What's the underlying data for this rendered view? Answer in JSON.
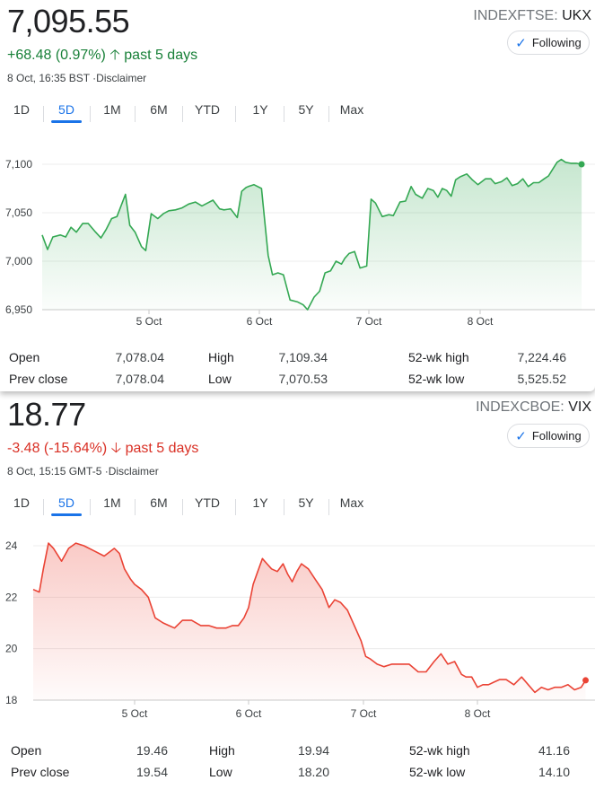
{
  "colors": {
    "up": "#188038",
    "down": "#d93025",
    "up_line": "#34a853",
    "down_line": "#ea4335",
    "accent": "#1a73e8"
  },
  "ranges": [
    "1D",
    "5D",
    "1M",
    "6M",
    "YTD",
    "1Y",
    "5Y",
    "Max"
  ],
  "selected_range": "5D",
  "follow_label": "Following",
  "panels": [
    {
      "price": "7,095.55",
      "exchange": "INDEXFTSE:",
      "symbol": "UKX",
      "change": "+68.48 (0.97%)",
      "period": "past 5 days",
      "timestamp": "8 Oct, 16:35 BST",
      "disclaimer": "·Disclaimer",
      "stats": {
        "open_label": "Open",
        "open": "7,078.04",
        "high_label": "High",
        "high": "7,109.34",
        "wkhigh_label": "52-wk high",
        "wkhigh": "7,224.46",
        "prev_label": "Prev close",
        "prev": "7,078.04",
        "low_label": "Low",
        "low": "7,070.53",
        "wklow_label": "52-wk low",
        "wklow": "5,525.52"
      }
    },
    {
      "price": "18.77",
      "exchange": "INDEXCBOE:",
      "symbol": "VIX",
      "change": "-3.48 (-15.64%)",
      "period": "past 5 days",
      "timestamp": "8 Oct, 15:15 GMT-5",
      "disclaimer": "·Disclaimer",
      "stats": {
        "open_label": "Open",
        "open": "19.46",
        "high_label": "High",
        "high": "19.94",
        "wkhigh_label": "52-wk high",
        "wkhigh": "41.16",
        "prev_label": "Prev close",
        "prev": "19.54",
        "low_label": "Low",
        "low": "18.20",
        "wklow_label": "52-wk low",
        "wklow": "14.10"
      }
    }
  ],
  "chart_data": [
    {
      "type": "area",
      "direction": "up",
      "yticks": [
        6950,
        7000,
        7050,
        7100
      ],
      "ytick_labels": [
        "6,950",
        "7,000",
        "7,050",
        "7,100"
      ],
      "ylim": [
        6950,
        7125
      ],
      "xlim": [
        0,
        5
      ],
      "xticks": [
        1,
        2,
        3,
        4
      ],
      "xtick_labels": [
        "5 Oct",
        "6 Oct",
        "7 Oct",
        "8 Oct"
      ],
      "grid": true,
      "x": [
        0.0,
        0.05,
        0.1,
        0.17,
        0.22,
        0.27,
        0.32,
        0.38,
        0.43,
        0.5,
        0.55,
        0.6,
        0.65,
        0.7,
        0.78,
        0.82,
        0.87,
        0.93,
        0.97,
        1.02,
        1.08,
        1.13,
        1.18,
        1.24,
        1.3,
        1.36,
        1.42,
        1.48,
        1.53,
        1.58,
        1.64,
        1.68,
        1.74,
        1.8,
        1.84,
        1.88,
        1.9,
        1.95,
        2.02,
        2.08,
        2.12,
        2.17,
        2.22,
        2.28,
        2.35,
        2.4,
        2.44,
        2.5,
        2.55,
        2.6,
        2.65,
        2.7,
        2.75,
        2.78,
        2.82,
        2.87,
        2.92,
        2.98,
        3.02,
        3.06,
        3.12,
        3.18,
        3.22,
        3.28,
        3.33,
        3.38,
        3.42,
        3.48,
        3.53,
        3.58,
        3.62,
        3.66,
        3.7,
        3.74,
        3.78,
        3.82,
        3.88,
        3.93,
        3.98,
        4.05,
        4.1,
        4.14,
        4.2,
        4.25,
        4.3,
        4.35,
        4.4,
        4.45,
        4.5,
        4.55,
        4.6,
        4.64,
        4.68,
        4.72,
        4.76,
        4.8,
        4.85,
        4.9,
        4.95
      ],
      "values": [
        7027,
        7012,
        7025,
        7027,
        7025,
        7035,
        7030,
        7039,
        7039,
        7030,
        7024,
        7033,
        7044,
        7046,
        7069,
        7037,
        7030,
        7015,
        7011,
        7049,
        7044,
        7049,
        7052,
        7053,
        7055,
        7059,
        7061,
        7057,
        7060,
        7063,
        7054,
        7053,
        7054,
        7045,
        7072,
        7076,
        7077,
        7079,
        7075,
        7006,
        6986,
        6988,
        6986,
        6960,
        6958,
        6955,
        6950,
        6963,
        6969,
        6988,
        6990,
        7000,
        6997,
        7003,
        7008,
        7010,
        6993,
        6995,
        7064,
        7060,
        7046,
        7048,
        7047,
        7061,
        7062,
        7077,
        7069,
        7065,
        7075,
        7073,
        7066,
        7075,
        7073,
        7067,
        7084,
        7087,
        7090,
        7084,
        7079,
        7085,
        7085,
        7080,
        7082,
        7086,
        7078,
        7080,
        7085,
        7077,
        7081,
        7081,
        7085,
        7088,
        7095,
        7102,
        7105,
        7102,
        7101,
        7101,
        7100
      ]
    },
    {
      "type": "area",
      "direction": "down",
      "yticks": [
        18,
        20,
        22,
        24
      ],
      "ytick_labels": [
        "18",
        "20",
        "22",
        "24"
      ],
      "ylim": [
        18,
        24.7
      ],
      "xlim": [
        0,
        5
      ],
      "xticks": [
        1,
        2,
        3,
        4
      ],
      "xtick_labels": [
        "5 Oct",
        "6 Oct",
        "7 Oct",
        "8 Oct"
      ],
      "grid": true,
      "x": [
        0.0,
        0.06,
        0.1,
        0.15,
        0.2,
        0.28,
        0.35,
        0.42,
        0.5,
        0.6,
        0.7,
        0.8,
        0.85,
        0.9,
        0.96,
        1.0,
        1.06,
        1.12,
        1.18,
        1.25,
        1.3,
        1.35,
        1.42,
        1.5,
        1.58,
        1.65,
        1.72,
        1.8,
        1.86,
        1.91,
        1.96,
        2.0,
        2.04,
        2.08,
        2.12,
        2.16,
        2.2,
        2.25,
        2.3,
        2.34,
        2.38,
        2.42,
        2.46,
        2.52,
        2.58,
        2.64,
        2.7,
        2.75,
        2.8,
        2.86,
        2.92,
        2.98,
        3.02,
        3.06,
        3.12,
        3.18,
        3.25,
        3.32,
        3.4,
        3.48,
        3.55,
        3.62,
        3.68,
        3.74,
        3.8,
        3.86,
        3.9,
        3.95,
        4.0,
        4.05,
        4.1,
        4.15,
        4.2,
        4.26,
        4.33,
        4.4,
        4.46,
        4.52,
        4.58,
        4.64,
        4.7,
        4.76,
        4.82,
        4.88,
        4.94,
        4.98
      ],
      "values": [
        22.3,
        22.2,
        23.1,
        24.1,
        23.9,
        23.4,
        23.9,
        24.1,
        24.0,
        23.8,
        23.6,
        23.9,
        23.7,
        23.1,
        22.7,
        22.5,
        22.3,
        22.0,
        21.2,
        21.0,
        20.9,
        20.8,
        21.1,
        21.1,
        20.9,
        20.9,
        20.8,
        20.8,
        20.9,
        20.9,
        21.2,
        21.6,
        22.5,
        23.0,
        23.5,
        23.3,
        23.1,
        23.0,
        23.3,
        22.9,
        22.6,
        23.0,
        23.3,
        23.1,
        22.7,
        22.3,
        21.6,
        21.9,
        21.8,
        21.5,
        20.9,
        20.3,
        19.7,
        19.6,
        19.4,
        19.3,
        19.4,
        19.4,
        19.4,
        19.1,
        19.1,
        19.5,
        19.8,
        19.4,
        19.5,
        19.0,
        18.9,
        18.9,
        18.5,
        18.6,
        18.6,
        18.7,
        18.8,
        18.8,
        18.6,
        18.9,
        18.6,
        18.3,
        18.5,
        18.4,
        18.5,
        18.5,
        18.6,
        18.4,
        18.5,
        18.77
      ]
    }
  ]
}
